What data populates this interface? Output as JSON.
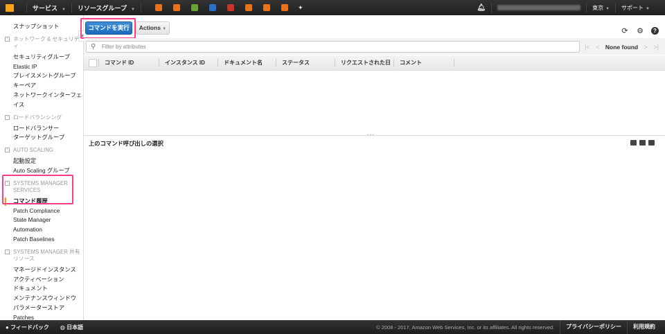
{
  "topnav": {
    "services": "サービス",
    "resource_groups": "リソースグループ",
    "region": "東京",
    "support": "サポート",
    "service_icons": [
      {
        "name": "service-icon-1",
        "color": "#e8731b"
      },
      {
        "name": "service-icon-2",
        "color": "#e8731b"
      },
      {
        "name": "service-icon-3",
        "color": "#6aa233"
      },
      {
        "name": "service-icon-4",
        "color": "#2a6fc9"
      },
      {
        "name": "service-icon-5",
        "color": "#c9352a"
      },
      {
        "name": "service-icon-6",
        "color": "#e8731b"
      },
      {
        "name": "service-icon-7",
        "color": "#e8731b"
      },
      {
        "name": "service-icon-8",
        "color": "#e8731b"
      }
    ]
  },
  "sidebar": {
    "top_item": "スナップショット",
    "sections": [
      {
        "title": "ネットワーク & セキュリティ",
        "items": [
          "セキュリティグループ",
          "Elastic IP",
          "プレイスメントグループ",
          "キーペア",
          "ネットワークインターフェイス"
        ]
      },
      {
        "title": "ロードバランシング",
        "items": [
          "ロードバランサー",
          "ターゲットグループ"
        ]
      },
      {
        "title": "AUTO SCALING",
        "items": [
          "起動設定",
          "Auto Scaling グループ"
        ]
      },
      {
        "title": "SYSTEMS MANAGER SERVICES",
        "items": [
          "コマンド履歴",
          "Patch Compliance",
          "State Manager",
          "Automation",
          "Patch Baselines"
        ]
      },
      {
        "title": "SYSTEMS MANAGER 共有リソース",
        "items": [
          "マネージドインスタンス",
          "アクティベーション",
          "ドキュメント",
          "メンテナンスウィンドウ",
          "パラメーターストア",
          "Patches"
        ]
      }
    ]
  },
  "main": {
    "run_command": "コマンドを実行",
    "actions": "Actions",
    "filter_placeholder": "Filter by attributes",
    "pager": "None found",
    "columns": [
      "コマンド ID",
      "インスタンス ID",
      "ドキュメント名",
      "ステータス",
      "リクエストされた日",
      "コメント"
    ],
    "lower_title": "上のコマンド呼び出しの選択"
  },
  "footer": {
    "feedback": "フィードバック",
    "language": "日本語",
    "copyright": "© 2008 - 2017, Amazon Web Services, Inc. or its affiliates. All rights reserved.",
    "privacy": "プライバシーポリシー",
    "terms": "利用規約"
  }
}
